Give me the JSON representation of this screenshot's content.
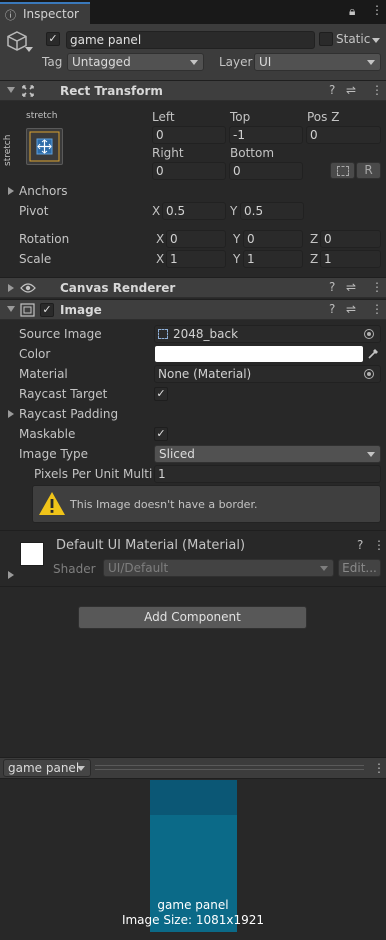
{
  "tab": {
    "label": "Inspector"
  },
  "object": {
    "name": "game panel",
    "static_label": "Static",
    "tag_label": "Tag",
    "tag_value": "Untagged",
    "layer_label": "Layer",
    "layer_value": "UI"
  },
  "rect_transform": {
    "title": "Rect Transform",
    "anchor_preset_top": "stretch",
    "anchor_preset_side": "stretch",
    "left_label": "Left",
    "top_label": "Top",
    "posz_label": "Pos Z",
    "left": "0",
    "top": "-1",
    "posz": "0",
    "right_label": "Right",
    "bottom_label": "Bottom",
    "right": "0",
    "bottom": "0",
    "raw_button": "R",
    "anchors_label": "Anchors",
    "pivot_label": "Pivot",
    "pivot_x": "0.5",
    "pivot_y": "0.5",
    "rotation_label": "Rotation",
    "rot_x": "0",
    "rot_y": "0",
    "rot_z": "0",
    "scale_label": "Scale",
    "scale_x": "1",
    "scale_y": "1",
    "scale_z": "1",
    "x": "X",
    "y": "Y",
    "z": "Z"
  },
  "canvas_renderer": {
    "title": "Canvas Renderer"
  },
  "image": {
    "title": "Image",
    "source_image_label": "Source Image",
    "source_image": "2048_back",
    "color_label": "Color",
    "color_value": "#ffffff",
    "material_label": "Material",
    "material": "None (Material)",
    "raycast_target_label": "Raycast Target",
    "raycast_padding_label": "Raycast Padding",
    "maskable_label": "Maskable",
    "image_type_label": "Image Type",
    "image_type": "Sliced",
    "ppu_label": "Pixels Per Unit Multip",
    "ppu": "1",
    "warning": "This Image doesn't have a border."
  },
  "material_block": {
    "title": "Default UI Material (Material)",
    "shader_label": "Shader",
    "shader": "UI/Default",
    "edit_button": "Edit..."
  },
  "add_component": "Add Component",
  "preview": {
    "dropdown": "game panel",
    "name": "game panel",
    "size": "Image Size: 1081x1921"
  }
}
